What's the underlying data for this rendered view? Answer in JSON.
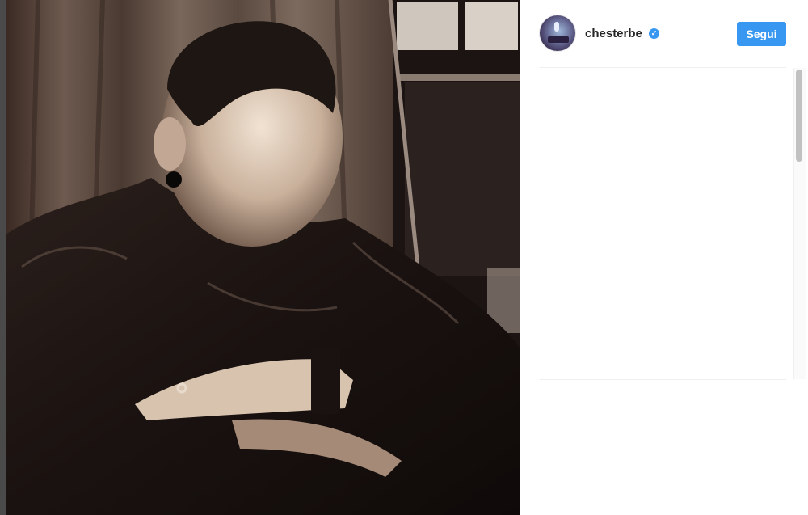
{
  "post": {
    "image_alt": "Black and white portrait of a man in a leather jacket resting his arms",
    "author": {
      "username": "chesterbe",
      "verified": true,
      "verified_icon": "verified-badge-icon"
    },
    "follow_label": "Segui"
  },
  "colors": {
    "accent": "#3897f0",
    "username": "#262626",
    "divider": "#efefef"
  }
}
